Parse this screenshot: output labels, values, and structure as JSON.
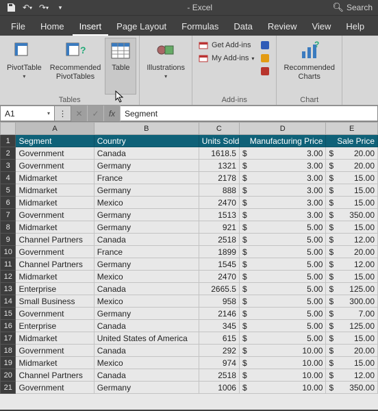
{
  "titlebar": {
    "app_title": "- Excel",
    "search_label": "Search"
  },
  "tabs": [
    "File",
    "Home",
    "Insert",
    "Page Layout",
    "Formulas",
    "Data",
    "Review",
    "View",
    "Help"
  ],
  "active_tab_index": 2,
  "ribbon": {
    "groups": [
      {
        "label": "Tables",
        "buttons": [
          {
            "name": "pivottable",
            "label": "PivotTable",
            "dropdown": true
          },
          {
            "name": "recommended-pivottables",
            "label": "Recommended\nPivotTables",
            "dropdown": false
          },
          {
            "name": "table",
            "label": "Table",
            "dropdown": false,
            "hover": true
          }
        ]
      },
      {
        "label": "",
        "buttons": [
          {
            "name": "illustrations",
            "label": "Illustrations",
            "dropdown": true
          }
        ]
      },
      {
        "label": "Add-ins",
        "small": [
          {
            "name": "get-addins",
            "label": "Get Add-ins"
          },
          {
            "name": "my-addins",
            "label": "My Add-ins",
            "dropdown": true
          }
        ],
        "extras": [
          "visio",
          "bing",
          "people"
        ]
      },
      {
        "label": "Chart",
        "buttons": [
          {
            "name": "recommended-charts",
            "label": "Recommended\nCharts",
            "dropdown": false
          }
        ]
      }
    ]
  },
  "namebox": {
    "value": "A1"
  },
  "formula": {
    "value": "Segment"
  },
  "columns": [
    "A",
    "B",
    "C",
    "D",
    "E"
  ],
  "header_row": [
    "Segment",
    "Country",
    "Units Sold",
    "Manufacturing Price",
    "Sale Price"
  ],
  "rows": [
    {
      "n": 2,
      "segment": "Government",
      "country": "Canada",
      "units": "1618.5",
      "mfg": "3.00",
      "sale": "20.00"
    },
    {
      "n": 3,
      "segment": "Government",
      "country": "Germany",
      "units": "1321",
      "mfg": "3.00",
      "sale": "20.00"
    },
    {
      "n": 4,
      "segment": "Midmarket",
      "country": "France",
      "units": "2178",
      "mfg": "3.00",
      "sale": "15.00"
    },
    {
      "n": 5,
      "segment": "Midmarket",
      "country": "Germany",
      "units": "888",
      "mfg": "3.00",
      "sale": "15.00"
    },
    {
      "n": 6,
      "segment": "Midmarket",
      "country": "Mexico",
      "units": "2470",
      "mfg": "3.00",
      "sale": "15.00"
    },
    {
      "n": 7,
      "segment": "Government",
      "country": "Germany",
      "units": "1513",
      "mfg": "3.00",
      "sale": "350.00"
    },
    {
      "n": 8,
      "segment": "Midmarket",
      "country": "Germany",
      "units": "921",
      "mfg": "5.00",
      "sale": "15.00"
    },
    {
      "n": 9,
      "segment": "Channel Partners",
      "country": "Canada",
      "units": "2518",
      "mfg": "5.00",
      "sale": "12.00"
    },
    {
      "n": 10,
      "segment": "Government",
      "country": "France",
      "units": "1899",
      "mfg": "5.00",
      "sale": "20.00"
    },
    {
      "n": 11,
      "segment": "Channel Partners",
      "country": "Germany",
      "units": "1545",
      "mfg": "5.00",
      "sale": "12.00"
    },
    {
      "n": 12,
      "segment": "Midmarket",
      "country": "Mexico",
      "units": "2470",
      "mfg": "5.00",
      "sale": "15.00"
    },
    {
      "n": 13,
      "segment": "Enterprise",
      "country": "Canada",
      "units": "2665.5",
      "mfg": "5.00",
      "sale": "125.00"
    },
    {
      "n": 14,
      "segment": "Small Business",
      "country": "Mexico",
      "units": "958",
      "mfg": "5.00",
      "sale": "300.00"
    },
    {
      "n": 15,
      "segment": "Government",
      "country": "Germany",
      "units": "2146",
      "mfg": "5.00",
      "sale": "7.00"
    },
    {
      "n": 16,
      "segment": "Enterprise",
      "country": "Canada",
      "units": "345",
      "mfg": "5.00",
      "sale": "125.00"
    },
    {
      "n": 17,
      "segment": "Midmarket",
      "country": "United States of America",
      "units": "615",
      "mfg": "5.00",
      "sale": "15.00"
    },
    {
      "n": 18,
      "segment": "Government",
      "country": "Canada",
      "units": "292",
      "mfg": "10.00",
      "sale": "20.00"
    },
    {
      "n": 19,
      "segment": "Midmarket",
      "country": "Mexico",
      "units": "974",
      "mfg": "10.00",
      "sale": "15.00"
    },
    {
      "n": 20,
      "segment": "Channel Partners",
      "country": "Canada",
      "units": "2518",
      "mfg": "10.00",
      "sale": "12.00"
    },
    {
      "n": 21,
      "segment": "Government",
      "country": "Germany",
      "units": "1006",
      "mfg": "10.00",
      "sale": "350.00"
    }
  ]
}
